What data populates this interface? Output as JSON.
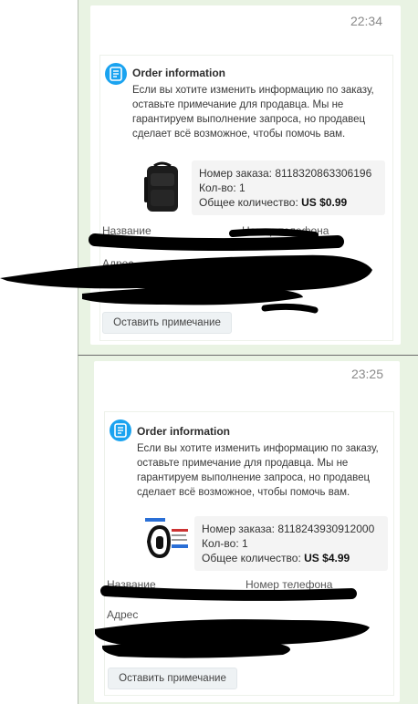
{
  "messages": [
    {
      "time": "22:34",
      "card": {
        "title": "Order information",
        "icon": "document-icon",
        "message": "Если вы хотите изменить информацию по заказу, оставьте примечание для продавца. Мы не гарантируем выполнение запроса, но продавец сделает всё возможное, чтобы помочь вам.",
        "product_image": "black backpack",
        "order_label": "Номер заказа:",
        "order_number": "8118320863306196",
        "qty_label": "Кол-во:",
        "qty": "1",
        "total_label": "Общее количество:",
        "total": "US $0.99",
        "name_label": "Название",
        "phone_label": "Номер телефона",
        "address_label": "Адрес",
        "note_button": "Оставить примечание"
      }
    },
    {
      "time": "23:25",
      "card": {
        "title": "Order information",
        "icon": "document-icon",
        "message": "Если вы хотите изменить информацию по заказу, оставьте примечание для продавца. Мы не гарантируем выполнение запроса, но продавец сделает всё возможное, чтобы помочь вам.",
        "product_image": "fitness band",
        "order_label": "Номер заказа:",
        "order_number": "8118243930912000",
        "qty_label": "Кол-во:",
        "qty": "1",
        "total_label": "Общее количество:",
        "total": "US $4.99",
        "name_label": "Название",
        "phone_label": "Номер телефона",
        "address_label": "Адрес",
        "note_button": "Оставить примечание"
      }
    }
  ],
  "colors": {
    "panel_bg": "#e9f3e3",
    "icon_blue": "#1aa3f0",
    "redaction": "#000000"
  }
}
